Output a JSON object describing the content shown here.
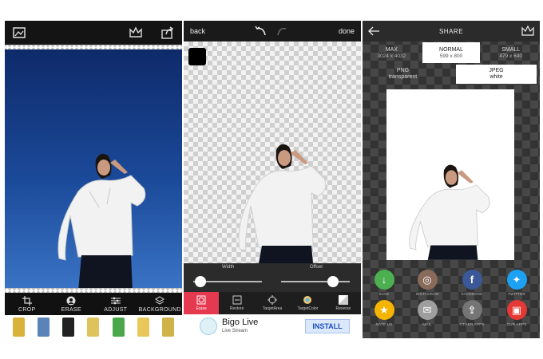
{
  "editor": {
    "tools": [
      {
        "label": "CROP",
        "icon": "crop-icon"
      },
      {
        "label": "ERASE",
        "icon": "erase-icon"
      },
      {
        "label": "ADJUST",
        "icon": "adjust-icon"
      },
      {
        "label": "BACKGROUND",
        "icon": "layers-icon"
      }
    ]
  },
  "eraser": {
    "back_label": "back",
    "done_label": "done",
    "width_label": "Width",
    "offset_label": "Offset",
    "width_value": 0.1,
    "offset_value": 0.75,
    "tools": [
      {
        "label": "Erase",
        "icon": "erase-icon",
        "active": true
      },
      {
        "label": "Restore",
        "icon": "restore-icon",
        "active": false
      },
      {
        "label": "TargetArea",
        "icon": "target-icon",
        "active": false
      },
      {
        "label": "TargetColor",
        "icon": "color-icon",
        "active": false
      },
      {
        "label": "Reverse",
        "icon": "reverse-icon",
        "active": false
      }
    ],
    "ad": {
      "title": "Bigo Live",
      "subtitle": "Live Stream",
      "button": "INSTALL"
    }
  },
  "share": {
    "title": "SHARE",
    "sizes": [
      {
        "label": "MAX",
        "dims": "3024 x 4032",
        "selected": false
      },
      {
        "label": "NORMAL",
        "dims": "599 x 800",
        "selected": true
      },
      {
        "label": "SMALL",
        "dims": "479 x 640",
        "selected": false
      }
    ],
    "formats": [
      {
        "line1": "PNG",
        "line2": "transparent",
        "selected": false
      },
      {
        "line1": "JPEG",
        "line2": "white",
        "selected": true
      }
    ],
    "targets": [
      {
        "label": "SAVE",
        "color": "#4caf50",
        "icon": "download-icon"
      },
      {
        "label": "INSTAGRAM",
        "color": "#8a6a5a",
        "icon": "instagram-icon"
      },
      {
        "label": "FACEBOOK",
        "color": "#3b5998",
        "icon": "facebook-icon"
      },
      {
        "label": "TWITTER",
        "color": "#1da1f2",
        "icon": "twitter-icon"
      },
      {
        "label": "RATE US",
        "color": "#f4b400",
        "icon": "star-icon"
      },
      {
        "label": "MAIL",
        "color": "#9e9e9e",
        "icon": "mail-icon"
      },
      {
        "label": "OTHER APPS",
        "color": "#757575",
        "icon": "share-icon"
      },
      {
        "label": "OUR APPS",
        "color": "#e53935",
        "icon": "apps-icon"
      }
    ]
  }
}
